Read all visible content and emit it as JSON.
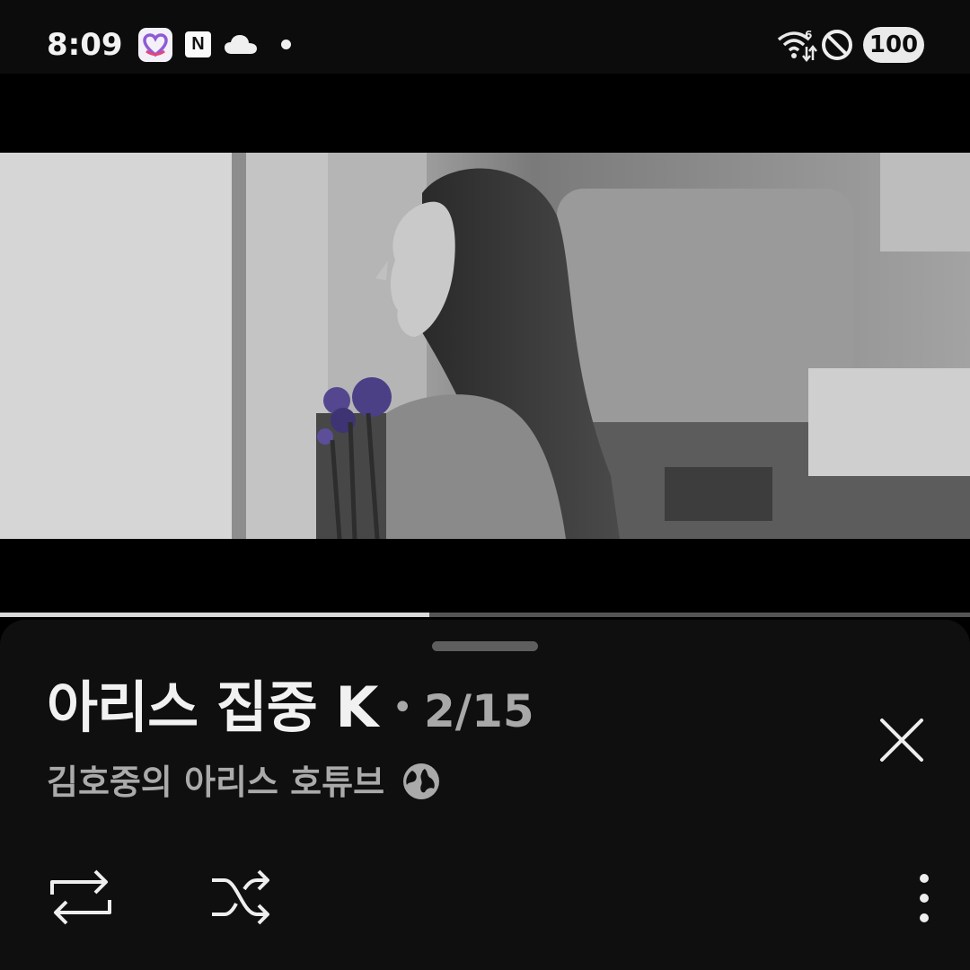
{
  "status_bar": {
    "time": "8:09",
    "app_badge_n": "N",
    "battery": "100",
    "icons": [
      "heart-app-icon",
      "n-app-icon",
      "cloud-icon",
      "notification-dot",
      "wifi-icon",
      "do-not-disturb-icon"
    ]
  },
  "player": {
    "progress_fraction": 0.443
  },
  "playlist": {
    "title": "아리스 집중 K",
    "separator": "•",
    "position": "2/15",
    "channel": "김호중의 아리스 호튜브"
  },
  "controls": {
    "icons": [
      "repeat-icon",
      "shuffle-icon",
      "close-icon",
      "more-vert-icon",
      "globe-icon"
    ]
  },
  "colors": {
    "background": "#000000",
    "sheet": "#0f0f0f",
    "title_text": "#f1f1f1",
    "secondary_text": "#aaaaaa"
  }
}
